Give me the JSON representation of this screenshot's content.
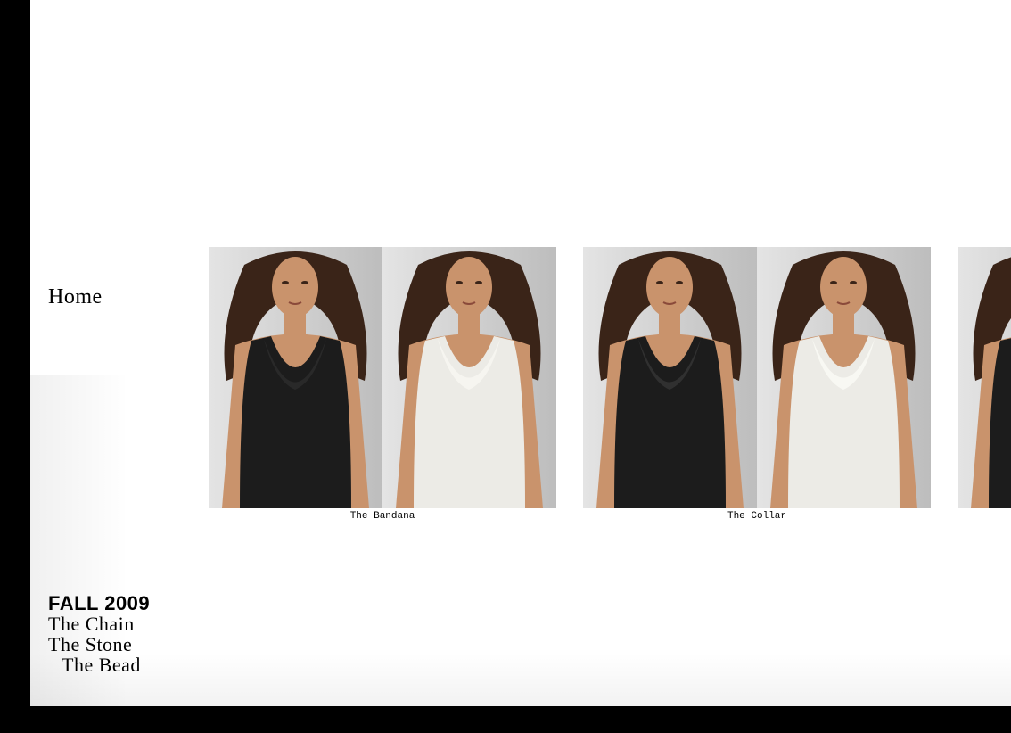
{
  "nav": {
    "home_label": "Home"
  },
  "collections": {
    "season_label": "FALL 2009",
    "items": [
      {
        "label": "The Chain"
      },
      {
        "label": "The Stone"
      },
      {
        "label": "The Bead"
      }
    ]
  },
  "looks": [
    {
      "caption": "The Bandana",
      "photos": [
        {
          "garment": "black bandana-neck tank top",
          "top_color": "#1c1c1c",
          "accent_color": "#2b2b2b"
        },
        {
          "garment": "white bandana-neck tank top",
          "top_color": "#ecebe6",
          "accent_color": "#f7f6f1"
        }
      ]
    },
    {
      "caption": "The Collar",
      "photos": [
        {
          "garment": "black lace-collar tank top",
          "top_color": "#1c1c1c",
          "accent_color": "#333333"
        },
        {
          "garment": "white lace-collar tank top",
          "top_color": "#ecebe6",
          "accent_color": "#faf9f4"
        }
      ]
    },
    {
      "caption": "",
      "photos": [
        {
          "garment": "partially visible black top",
          "top_color": "#1c1c1c",
          "accent_color": "#2b2b2b"
        }
      ]
    }
  ],
  "colors": {
    "background": "#ffffff",
    "frame": "#000000",
    "skin": "#c9936c",
    "hair": "#3a2418",
    "studio_wall": "#d9d9d9"
  }
}
